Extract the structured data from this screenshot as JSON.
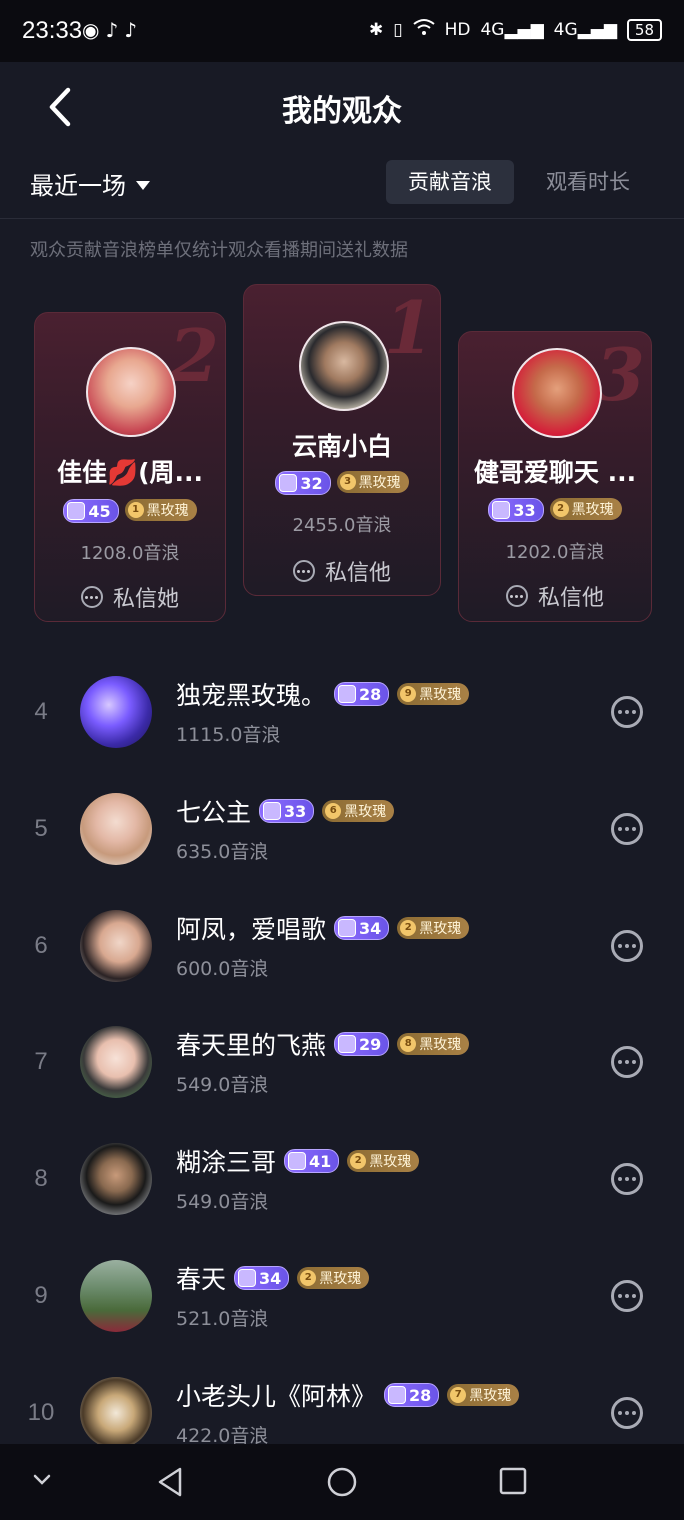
{
  "status_bar": {
    "time": "23:33",
    "left_icons": [
      "wechat-icon",
      "tiktok-icon",
      "tiktok-icon"
    ],
    "signal_labels": [
      "HD",
      "4G",
      "4G"
    ],
    "battery": "58"
  },
  "header": {
    "title": "我的观众"
  },
  "filter": {
    "session": "最近一场",
    "tabs": [
      {
        "label": "贡献音浪",
        "active": true
      },
      {
        "label": "观看时长",
        "active": false
      }
    ]
  },
  "hint": "观众贡献音浪榜单仅统计观众看播期间送礼数据",
  "podium": [
    {
      "rank": "2",
      "name": "佳佳💋(周...",
      "level": "45",
      "fan_level": "1",
      "fan_label": "黑玫瑰",
      "value": "1208.0音浪",
      "message": "私信她"
    },
    {
      "rank": "1",
      "name": "云南小白",
      "level": "32",
      "fan_level": "3",
      "fan_label": "黑玫瑰",
      "value": "2455.0音浪",
      "message": "私信他"
    },
    {
      "rank": "3",
      "name": "健哥爱聊天 ...",
      "level": "33",
      "fan_level": "2",
      "fan_label": "黑玫瑰",
      "value": "1202.0音浪",
      "message": "私信他"
    }
  ],
  "list": [
    {
      "rank": "4",
      "name": "独宠黑玫瑰。",
      "level": "28",
      "fan_level": "9",
      "fan_label": "黑玫瑰",
      "value": "1115.0音浪"
    },
    {
      "rank": "5",
      "name": "七公主",
      "level": "33",
      "fan_level": "6",
      "fan_label": "黑玫瑰",
      "value": "635.0音浪"
    },
    {
      "rank": "6",
      "name": "阿凤，爱唱歌",
      "level": "34",
      "fan_level": "2",
      "fan_label": "黑玫瑰",
      "value": "600.0音浪"
    },
    {
      "rank": "7",
      "name": "春天里的飞燕",
      "level": "29",
      "fan_level": "8",
      "fan_label": "黑玫瑰",
      "value": "549.0音浪"
    },
    {
      "rank": "8",
      "name": "糊涂三哥",
      "level": "41",
      "fan_level": "2",
      "fan_label": "黑玫瑰",
      "value": "549.0音浪"
    },
    {
      "rank": "9",
      "name": "春天",
      "level": "34",
      "fan_level": "2",
      "fan_label": "黑玫瑰",
      "value": "521.0音浪"
    },
    {
      "rank": "10",
      "name": "小老头儿《阿林》",
      "level": "28",
      "fan_level": "7",
      "fan_label": "黑玫瑰",
      "value": "422.0音浪"
    }
  ],
  "colors": {
    "background": "#181a25",
    "level_badge": "#7b62f0",
    "fan_badge": "#a07a3e",
    "podium_card": "#4a2030"
  }
}
